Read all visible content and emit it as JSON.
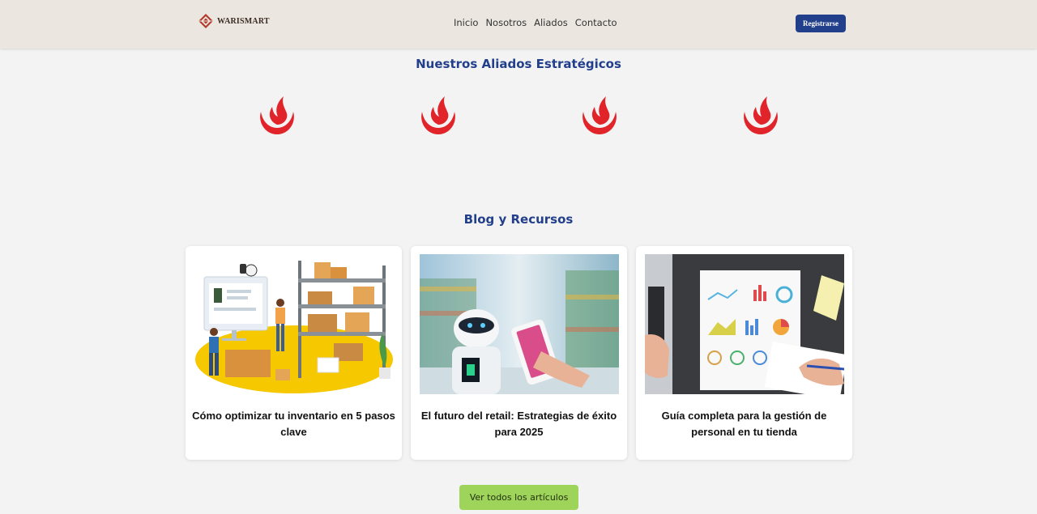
{
  "brand": {
    "name": "WARISMART"
  },
  "nav": {
    "items": [
      {
        "label": "Inicio"
      },
      {
        "label": "Nosotros"
      },
      {
        "label": "Aliados"
      },
      {
        "label": "Contacto"
      }
    ]
  },
  "header": {
    "register_label": "Registrarse"
  },
  "allies": {
    "title": "Nuestros Aliados Estratégicos",
    "logos": [
      "flame-logo",
      "flame-logo",
      "flame-logo",
      "flame-logo"
    ]
  },
  "blog": {
    "title": "Blog y Recursos",
    "cards": [
      {
        "title": "Cómo optimizar tu inventario en 5 pasos clave",
        "image": "inventory-warehouse-illustration"
      },
      {
        "title": "El futuro del retail: Estrategias de éxito para 2025",
        "image": "robot-supermarket-photo"
      },
      {
        "title": "Guía completa para la gestión de personal en tu tienda",
        "image": "analytics-reports-desk-photo"
      }
    ],
    "view_all_label": "Ver todos los artículos"
  },
  "colors": {
    "header_bg": "#ebe6e0",
    "page_bg": "#f3f3f3",
    "accent_blue": "#223f8c",
    "accent_green": "#9fd45b",
    "logo_red": "#e0242a"
  }
}
